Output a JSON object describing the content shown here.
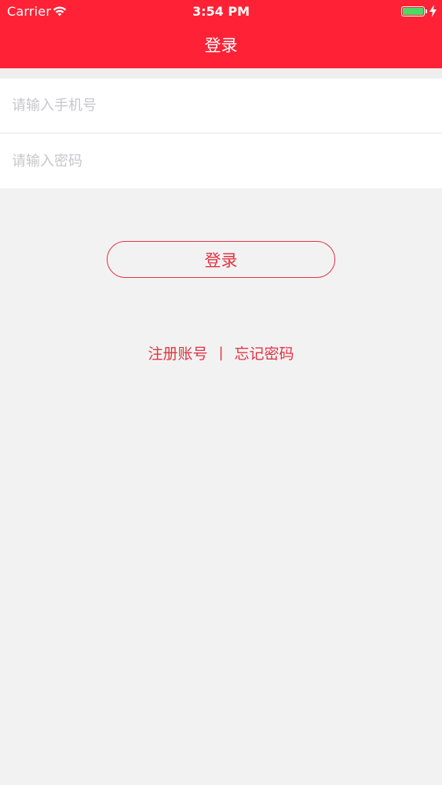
{
  "status_bar": {
    "carrier": "Carrier",
    "time": "3:54 PM",
    "battery_color": "#4cd964"
  },
  "nav": {
    "title": "登录",
    "background": "#ff2236"
  },
  "form": {
    "phone_placeholder": "请输入手机号",
    "phone_value": "",
    "password_placeholder": "请输入密码",
    "password_value": ""
  },
  "actions": {
    "login_label": "登录",
    "register_label": "注册账号",
    "divider": "|",
    "forgot_label": "忘记密码",
    "accent": "#e03543"
  },
  "icons": {
    "wifi": "wifi-icon",
    "battery": "battery-icon",
    "charging": "bolt-icon"
  }
}
